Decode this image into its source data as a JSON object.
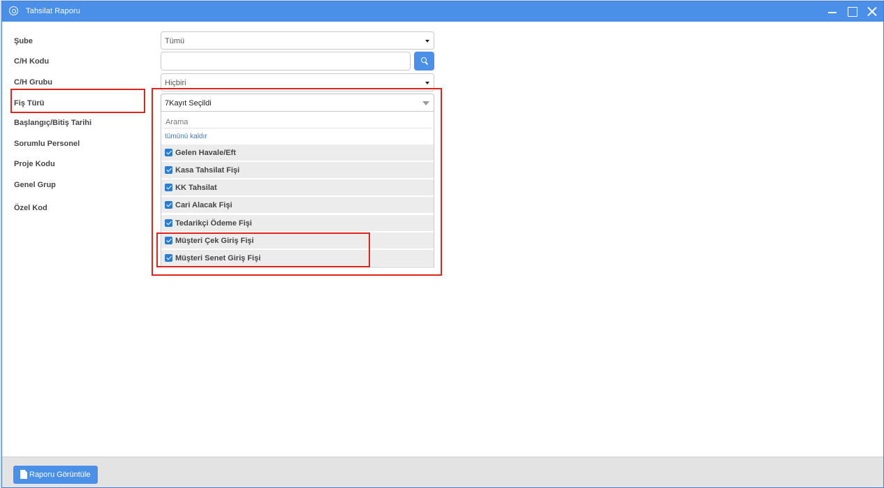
{
  "window": {
    "title": "Tahsilat Raporu"
  },
  "form": {
    "labels": {
      "sube": "Şube",
      "ch_kodu": "C/H Kodu",
      "ch_grubu": "C/H Grubu",
      "fis_turu": "Fiş Türü",
      "tarih": "Başlangıç/Bitiş Tarihi",
      "personel": "Sorumlu Personel",
      "proje": "Proje Kodu",
      "genel_grup": "Genel Grup",
      "ozel_kod": "Özel Kod"
    },
    "sube_value": "Tümü",
    "ch_kodu_value": "",
    "ch_grubu_value": "Hiçbiri",
    "fis_turu_value": "7Kayıt Seçildi"
  },
  "dropdown": {
    "search_placeholder": "Arama",
    "remove_all": "tümünü kaldır",
    "options": [
      {
        "label": "Gelen Havale/Eft",
        "checked": true
      },
      {
        "label": "Kasa Tahsilat Fişi",
        "checked": true
      },
      {
        "label": "KK Tahsilat",
        "checked": true
      },
      {
        "label": "Cari Alacak Fişi",
        "checked": true
      },
      {
        "label": "Tedarikçi Ödeme Fişi",
        "checked": true
      },
      {
        "label": "Müşteri Çek Giriş Fişi",
        "checked": true
      },
      {
        "label": "Müşteri Senet Giriş Fişi",
        "checked": true
      }
    ]
  },
  "footer": {
    "report_button": "Raporu Görüntüle"
  },
  "colors": {
    "titlebar": "#4a90e8",
    "accent": "#4a90e8",
    "highlight": "#e0231b",
    "checkbox": "#2b7cd3"
  },
  "icons": {
    "app": "settings-circle-icon",
    "search": "search-icon",
    "report": "document-icon"
  }
}
